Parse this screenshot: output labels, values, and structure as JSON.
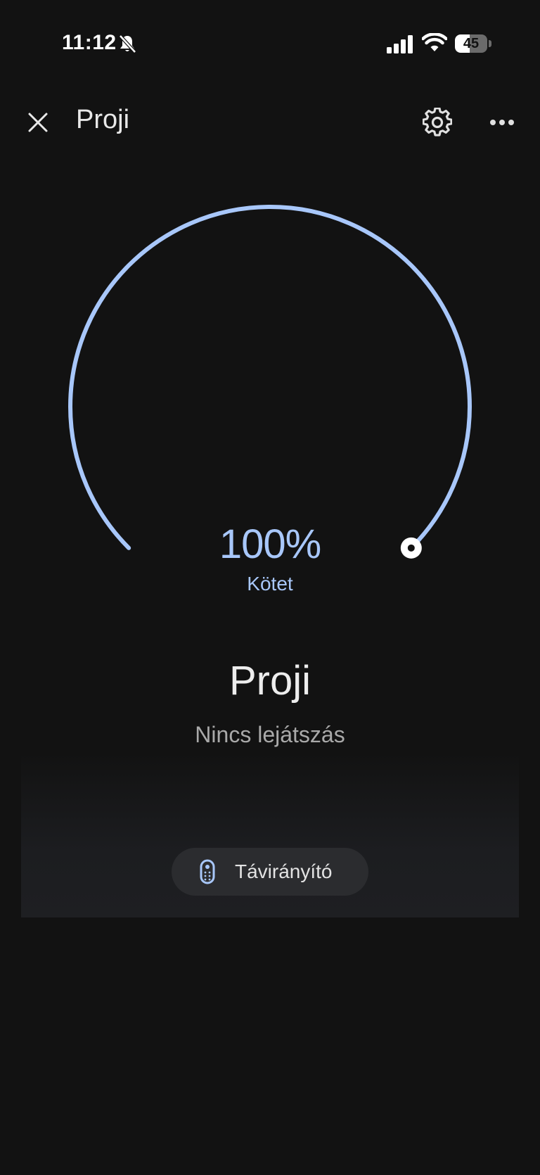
{
  "status_bar": {
    "time": "11:12",
    "battery_level": "45",
    "battery_fraction": 0.45,
    "icons": [
      "bell-slash-icon",
      "cellular-signal-icon",
      "wifi-icon",
      "battery-icon"
    ]
  },
  "app_bar": {
    "title": "Proji",
    "close_icon": "close-icon",
    "settings_icon": "gear-icon",
    "more_icon": "more-horizontal-icon"
  },
  "volume": {
    "value_text": "100%",
    "label": "Kötet",
    "level": 1.0,
    "accent_color": "#a8c7fa"
  },
  "device": {
    "name": "Proji",
    "status": "Nincs lejátszás"
  },
  "remote_button": {
    "label": "Távirányító",
    "icon": "remote-control-icon"
  },
  "colors": {
    "background": "#121212",
    "accent": "#a8c7fa",
    "chip_background": "#2b2c2f"
  }
}
